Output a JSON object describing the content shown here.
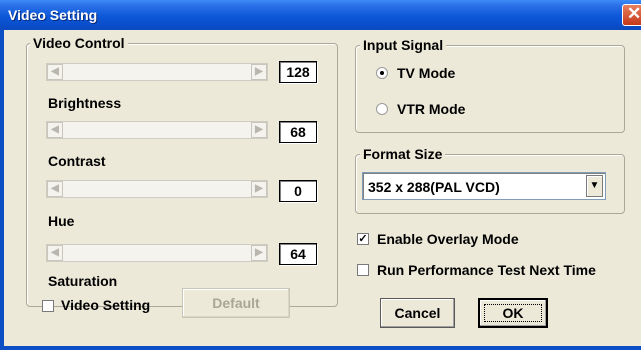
{
  "window": {
    "title": "Video Setting",
    "close_glyph": "✕"
  },
  "video_control": {
    "legend": "Video Control",
    "arrow_left": "◀",
    "arrow_right": "▶",
    "brightness": {
      "value": "128",
      "label": "Brightness"
    },
    "contrast": {
      "value": "68",
      "label": "Contrast"
    },
    "hue": {
      "value": "0",
      "label": "Hue"
    },
    "saturation": {
      "value": "64",
      "label": "Saturation"
    },
    "video_setting_checkbox": {
      "label": "Video Setting",
      "checked": false
    },
    "default_button": "Default"
  },
  "input_signal": {
    "legend": "Input Signal",
    "tv_mode": {
      "label": "TV Mode",
      "selected": true
    },
    "vtr_mode": {
      "label": "VTR Mode",
      "selected": false
    }
  },
  "format_size": {
    "legend": "Format Size",
    "selected": "352 x 288(PAL VCD)",
    "dropdown_glyph": "▼"
  },
  "options": {
    "enable_overlay": {
      "label": "Enable Overlay Mode",
      "checked": true,
      "mark": "✓"
    },
    "run_performance": {
      "label": "Run Performance Test Next Time",
      "checked": false
    }
  },
  "buttons": {
    "cancel": "Cancel",
    "ok": "OK"
  },
  "colors": {
    "titlebar": "#0a54d6",
    "dialog_bg": "#ece9d8",
    "disabled_text": "#a9a697"
  }
}
